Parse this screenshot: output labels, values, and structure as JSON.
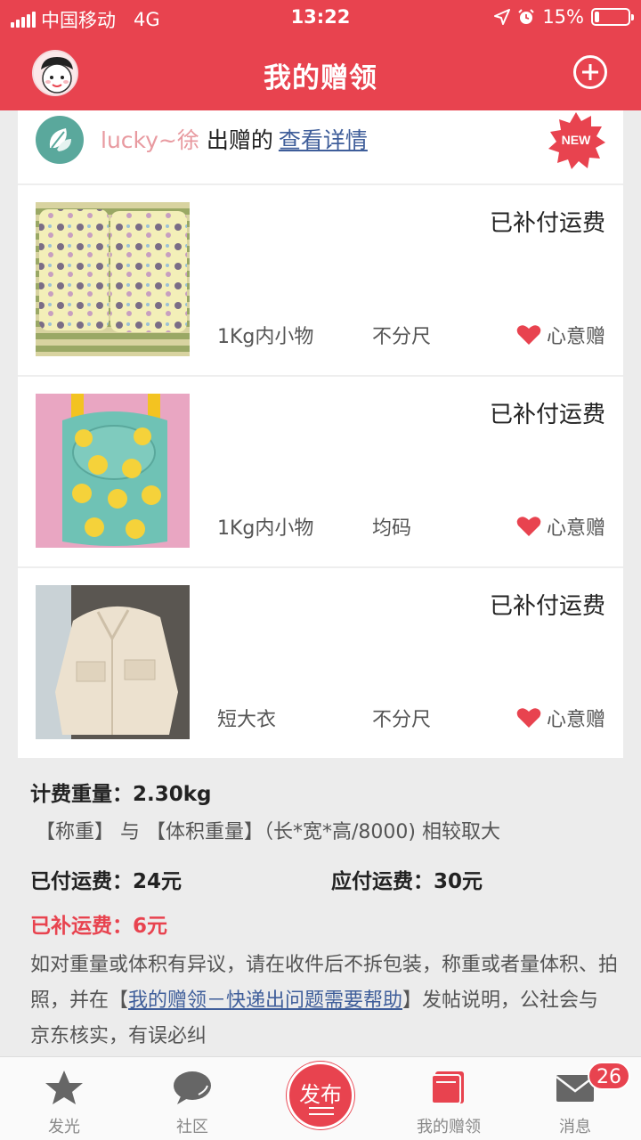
{
  "status_bar": {
    "carrier": "中国移动",
    "network": "4G",
    "time": "13:22",
    "battery": "15%",
    "battery_level": 0.15
  },
  "nav": {
    "title": "我的赠领",
    "add_icon": "plus-circle-icon"
  },
  "giver": {
    "name": "lucky~徐",
    "verb": "出赠的",
    "link": "查看详情",
    "badge": "NEW"
  },
  "items": [
    {
      "status": "已补付运费",
      "name": "1Kg内小物",
      "size": "不分尺",
      "tag": "心意赠"
    },
    {
      "status": "已补付运费",
      "name": "1Kg内小物",
      "size": "均码",
      "tag": "心意赠"
    },
    {
      "status": "已补付运费",
      "name": "短大衣",
      "size": "不分尺",
      "tag": "心意赠"
    }
  ],
  "info": {
    "weight_label": "计费重量：",
    "weight_value": "2.30kg",
    "rule": "【称重】 与 【体积重量】（长*宽*高/8000) 相较取大",
    "paid_label": "已付运费：",
    "paid_value": "24元",
    "due_label": "应付运费：",
    "due_value": "30元",
    "supp_label": "已补运费：",
    "supp_value": "6元",
    "note_before": "如对重量或体积有异议，请在收件后不拆包装，称重或者量体积、拍照，并在【",
    "note_link": "我的赠领－快递出问题需要帮助",
    "note_after": "】发帖说明，公社会与京东核实，有误必纠"
  },
  "tabs": [
    {
      "label": "发光",
      "icon": "star-icon"
    },
    {
      "label": "社区",
      "icon": "chat-bubble-icon"
    },
    {
      "label": "发布",
      "icon": "publish-icon"
    },
    {
      "label": "我的赠领",
      "icon": "gift-book-icon"
    },
    {
      "label": "消息",
      "icon": "mail-icon"
    }
  ],
  "message_badge": "26",
  "colors": {
    "brand": "#e8434f",
    "link": "#3f5e9a"
  }
}
